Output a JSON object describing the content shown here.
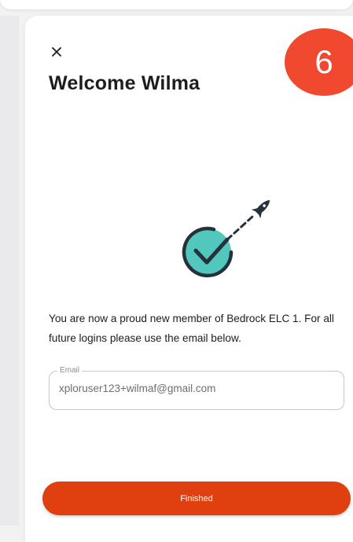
{
  "modal": {
    "close_glyph": "×",
    "title": "Welcome Wilma",
    "step_badge": "6",
    "message": "You are now a proud new member of Bedrock ELC 1. For all future logins please use the email below.",
    "email": {
      "label": "Email",
      "value": "xploruser123+wilmaf@gmail.com"
    },
    "finished_label": "Finished"
  },
  "icons": {
    "close": "close-icon",
    "illustration": "rocket-checkmark-icon"
  },
  "colors": {
    "accent": "#e0400f",
    "badge": "#f0492f",
    "check_circle": "#52c7bd",
    "ink": "#25313b"
  }
}
